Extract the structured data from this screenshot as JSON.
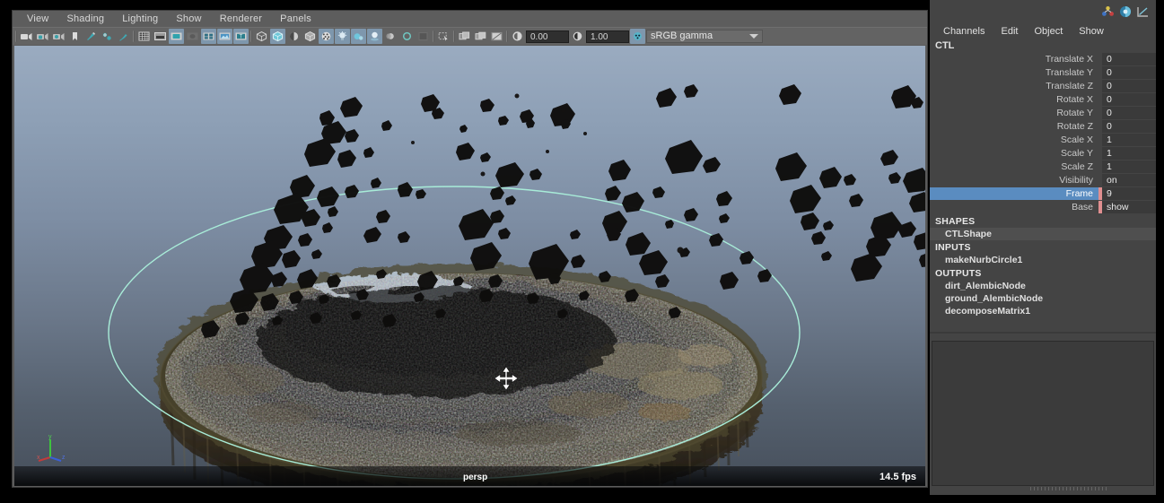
{
  "viewport_panel": {
    "menus": [
      "View",
      "Shading",
      "Lighting",
      "Show",
      "Renderer",
      "Panels"
    ],
    "toolbar": {
      "icons": [
        "camera-icon",
        "camera-lock-icon",
        "camera-attributes-icon",
        "bookmark-icon",
        "paint-effects-icon",
        "hardware-texture-icon",
        "paint-brush-icon",
        "grid-icon",
        "film-gate-icon",
        "resolution-gate-icon",
        "gate-mask-icon",
        "film-origin-icon",
        "image-plane-icon",
        "title-safe-icon",
        "wireframe-icon",
        "smooth-shade-all-icon",
        "smooth-shade-selected-icon",
        "flat-shade-icon",
        "wireframe-on-shaded-icon",
        "use-default-lights-icon",
        "use-all-lights-icon",
        "shadows-icon",
        "motion-blur-icon",
        "occlusion-icon",
        "viewport-texture-icon",
        "xray-icon",
        "xray-joints-icon",
        "isolate-select-icon",
        "grid-snap-icon",
        "two-panel-icon",
        "exposure-icon"
      ],
      "exposure_value": "0.00",
      "gamma_value": "1.00",
      "color_space": "sRGB gamma"
    },
    "viewport": {
      "camera_label": "persp",
      "fps_label": "14.5 fps",
      "axis_labels": [
        "x",
        "y",
        "z"
      ],
      "cursor": "move-cursor",
      "nurbs_circle_color": "#9fe6d2",
      "background_top": "#9aabc0",
      "background_bottom": "#464f5b"
    }
  },
  "channel_box": {
    "icons": [
      "character-sets-icon",
      "channel-box-layer-editor-icon",
      "graph-editor-icon"
    ],
    "menus": [
      "Channels",
      "Edit",
      "Object",
      "Show"
    ],
    "object_name": "CTL",
    "attributes": [
      {
        "label": "Translate X",
        "value": "0",
        "selected": false,
        "keyed": false
      },
      {
        "label": "Translate Y",
        "value": "0",
        "selected": false,
        "keyed": false
      },
      {
        "label": "Translate Z",
        "value": "0",
        "selected": false,
        "keyed": false
      },
      {
        "label": "Rotate X",
        "value": "0",
        "selected": false,
        "keyed": false
      },
      {
        "label": "Rotate Y",
        "value": "0",
        "selected": false,
        "keyed": false
      },
      {
        "label": "Rotate Z",
        "value": "0",
        "selected": false,
        "keyed": false
      },
      {
        "label": "Scale X",
        "value": "1",
        "selected": false,
        "keyed": false
      },
      {
        "label": "Scale Y",
        "value": "1",
        "selected": false,
        "keyed": false
      },
      {
        "label": "Scale Z",
        "value": "1",
        "selected": false,
        "keyed": false
      },
      {
        "label": "Visibility",
        "value": "on",
        "selected": false,
        "keyed": false
      },
      {
        "label": "Frame",
        "value": "9",
        "selected": true,
        "keyed": true
      },
      {
        "label": "Base",
        "value": "show",
        "selected": false,
        "keyed": true
      }
    ],
    "sections": [
      {
        "header": "SHAPES",
        "items": [
          {
            "name": "CTLShape",
            "highlighted": true
          }
        ]
      },
      {
        "header": "INPUTS",
        "items": [
          {
            "name": "makeNurbCircle1",
            "highlighted": false
          }
        ]
      },
      {
        "header": "OUTPUTS",
        "items": [
          {
            "name": "dirt_AlembicNode",
            "highlighted": false
          },
          {
            "name": "ground_AlembicNode",
            "highlighted": false
          },
          {
            "name": "decomposeMatrix1",
            "highlighted": false
          }
        ]
      }
    ],
    "selection_highlight_color": "#5a8cc0",
    "keyframe_marker_color": "#e08f90"
  }
}
